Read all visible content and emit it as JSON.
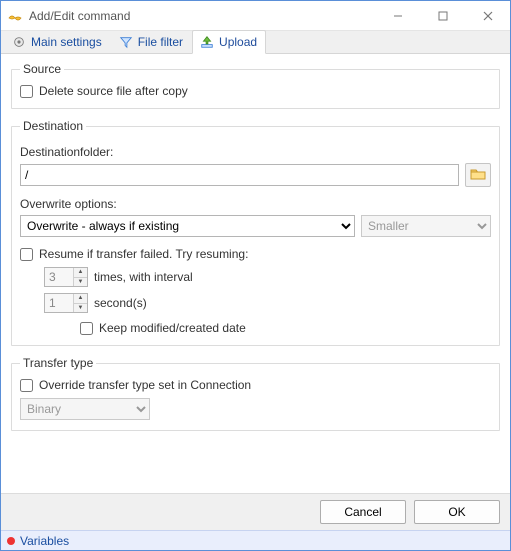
{
  "window": {
    "title": "Add/Edit command"
  },
  "tabs": {
    "main_settings": "Main settings",
    "file_filter": "File filter",
    "upload": "Upload"
  },
  "source": {
    "legend": "Source",
    "delete_after_copy": "Delete source file after copy"
  },
  "destination": {
    "legend": "Destination",
    "folder_label": "Destinationfolder:",
    "folder_value": "/",
    "overwrite_label": "Overwrite options:",
    "overwrite_value": "Overwrite - always if existing",
    "overwrite_cmp": "Smaller",
    "resume_label": "Resume if transfer failed. Try resuming:",
    "times_value": "3",
    "times_label": "times, with interval",
    "interval_value": "1",
    "interval_label": "second(s)",
    "keep_date_label": "Keep modified/created date"
  },
  "transfer": {
    "legend": "Transfer type",
    "override_label": "Override transfer type set in Connection",
    "type_value": "Binary"
  },
  "buttons": {
    "cancel": "Cancel",
    "ok": "OK"
  },
  "status": {
    "variables": "Variables"
  }
}
